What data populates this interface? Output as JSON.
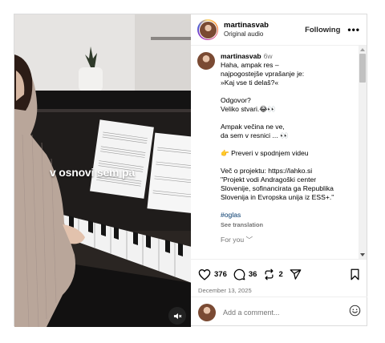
{
  "media": {
    "overlay_text": "v osnovi sem pa",
    "mute_icon": "speaker-muted-icon"
  },
  "header": {
    "username": "martinasvab",
    "subtitle": "Original audio",
    "follow_label": "Following",
    "more_label": "•••"
  },
  "caption": {
    "username": "martinasvab",
    "time": "6w",
    "lines": [
      "Haha, ampak res –",
      "najpogostejše vprašanje je:",
      "»Kaj vse ti delaš?«",
      "",
      "Odgovor?",
      "Veliko stvari.😂👀",
      "",
      "Ampak večina ne ve,",
      "da sem v resnici ... 👀",
      "",
      "👉 Preveri v spodnjem videu",
      "",
      "Več o projektu: https://lahko.si",
      "\"Projekt vodi Andragoški center",
      "Slovenije, sofinancirata ga Republika",
      "Slovenija in Evropska unija iz ESS+.\"",
      ""
    ],
    "hashtag": "#oglas",
    "see_translation": "See translation",
    "for_you": "For you ﹀"
  },
  "actions": {
    "likes": "376",
    "comments": "36",
    "reposts": "2",
    "date": "December 13, 2025"
  },
  "add_comment": {
    "placeholder": "Add a comment..."
  },
  "colors": {
    "link": "#00376b",
    "muted": "#737373",
    "border": "#dbdbdb"
  }
}
